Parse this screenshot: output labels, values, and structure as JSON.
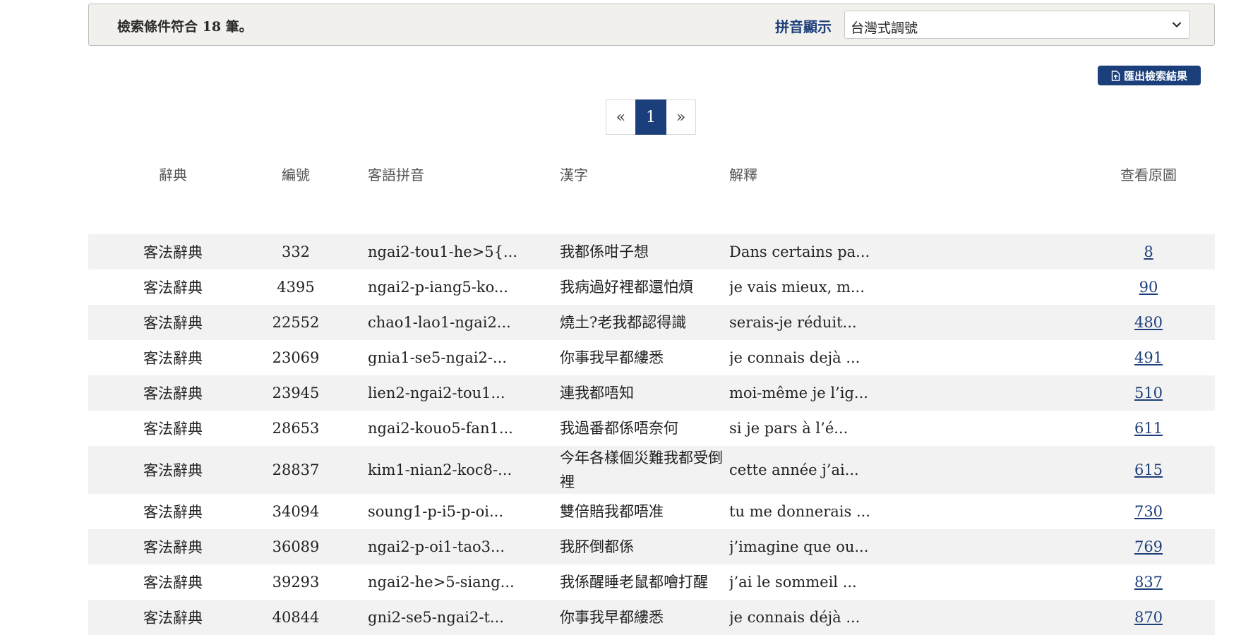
{
  "filter": {
    "result_count_text": "檢索條件符合 18 筆。",
    "pinyin_label": "拼音顯示",
    "pinyin_value": "台灣式調號"
  },
  "toolbar": {
    "export_label": "匯出檢索結果"
  },
  "pagination": {
    "prev": "«",
    "current": "1",
    "next": "»"
  },
  "table": {
    "headers": [
      "辭典",
      "編號",
      "客語拼音",
      "漢字",
      "解釋",
      "查看原圖"
    ],
    "rows": [
      {
        "dict": "客法辭典",
        "id": "332",
        "pinyin": "ngai2-tou1-he>5{...",
        "hanzi": "我都係咁子想",
        "explanation": "Dans certains pa...",
        "page": "8"
      },
      {
        "dict": "客法辭典",
        "id": "4395",
        "pinyin": "ngai2-p-iang5-ko...",
        "hanzi": "我病過好裡都還怕煩",
        "explanation": "je vais mieux, m...",
        "page": "90"
      },
      {
        "dict": "客法辭典",
        "id": "22552",
        "pinyin": "chao1-lao1-ngai2...",
        "hanzi": "燒土?老我都認得識",
        "explanation": "serais-je réduit...",
        "page": "480"
      },
      {
        "dict": "客法辭典",
        "id": "23069",
        "pinyin": "gnia1-se5-ngai2-...",
        "hanzi": "你事我早都縷悉",
        "explanation": "je connais dejà ...",
        "page": "491"
      },
      {
        "dict": "客法辭典",
        "id": "23945",
        "pinyin": "lien2-ngai2-tou1...",
        "hanzi": "連我都唔知",
        "explanation": "moi-même je l’ig...",
        "page": "510"
      },
      {
        "dict": "客法辭典",
        "id": "28653",
        "pinyin": "ngai2-kouo5-fan1...",
        "hanzi": "我過番都係唔奈何",
        "explanation": "si je pars à l’é...",
        "page": "611"
      },
      {
        "dict": "客法辭典",
        "id": "28837",
        "pinyin": "kim1-nian2-koc8-...",
        "hanzi": "今年各樣個災難我都受倒裡",
        "explanation": "cette année j’ai...",
        "page": "615"
      },
      {
        "dict": "客法辭典",
        "id": "34094",
        "pinyin": "soung1-p-i5-p-oi...",
        "hanzi": "雙倍賠我都唔准",
        "explanation": "tu me donnerais ...",
        "page": "730"
      },
      {
        "dict": "客法辭典",
        "id": "36089",
        "pinyin": "ngai2-p-oi1-tao3...",
        "hanzi": "我肧倒都係",
        "explanation": "j’imagine que ou...",
        "page": "769"
      },
      {
        "dict": "客法辭典",
        "id": "39293",
        "pinyin": "ngai2-he>5-siang...",
        "hanzi": "我係醒睡老鼠都噲打醒",
        "explanation": "j’ai le sommeil ...",
        "page": "837"
      },
      {
        "dict": "客法辭典",
        "id": "40844",
        "pinyin": "gni2-se5-ngai2-t...",
        "hanzi": "你事我早都縷悉",
        "explanation": "je connais déjà ...",
        "page": "870"
      }
    ]
  },
  "colors": {
    "accent": "#1b3f7b",
    "link": "#1e3f7a",
    "row_stripe": "#f2f2f2",
    "filter_bg": "#f1f0ec"
  },
  "icons": {
    "select_arrow": "chevron-down-icon",
    "export": "file-export-icon"
  }
}
